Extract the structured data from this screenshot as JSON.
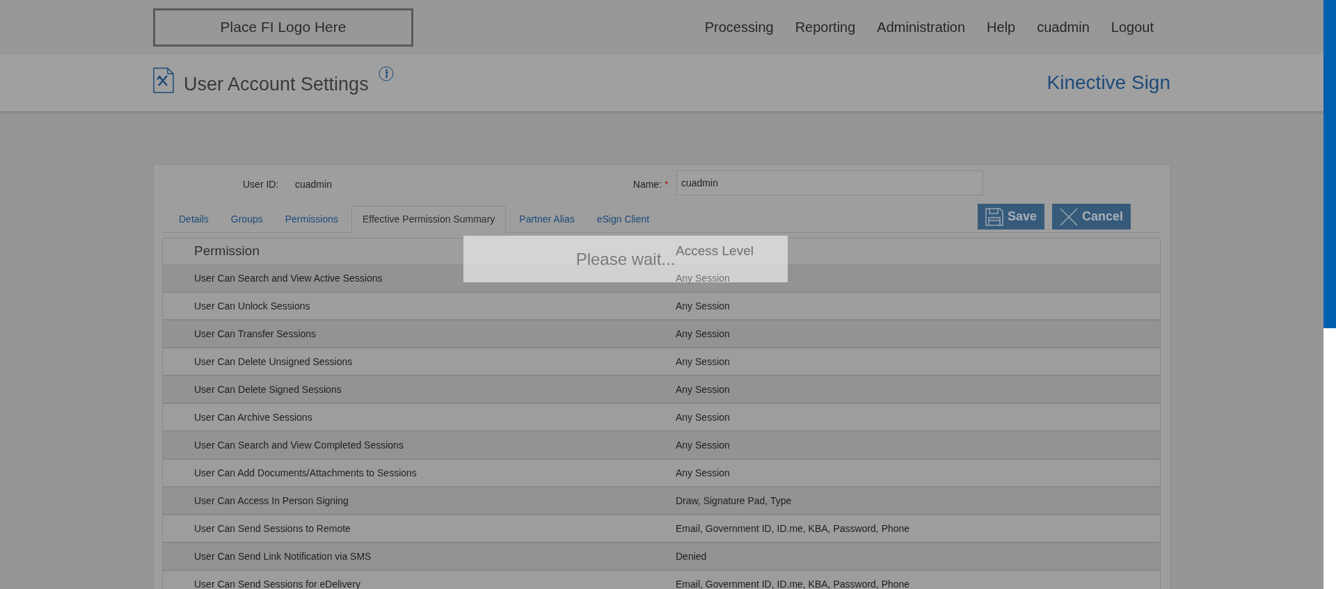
{
  "logo": {
    "text": "Place FI Logo Here"
  },
  "nav": [
    "Processing",
    "Reporting",
    "Administration",
    "Help",
    "cuadmin",
    "Logout"
  ],
  "page_title": "User Account Settings",
  "brand": "Kinective Sign",
  "user_id": {
    "label": "User ID:",
    "value": "cuadmin"
  },
  "name_field": {
    "label": "Name:",
    "required": true,
    "required_mark": "*",
    "value": "cuadmin"
  },
  "tabs": [
    {
      "label": "Details",
      "selected": false
    },
    {
      "label": "Groups",
      "selected": false
    },
    {
      "label": "Permissions",
      "selected": false
    },
    {
      "label": "Effective Permission Summary",
      "selected": true
    },
    {
      "label": "Partner Alias",
      "selected": false
    },
    {
      "label": "eSign Client",
      "selected": false
    }
  ],
  "buttons": [
    {
      "kind": "save",
      "label": "Save"
    },
    {
      "kind": "cancel",
      "label": "Cancel"
    }
  ],
  "table": {
    "columns": [
      "Permission",
      "Access Level"
    ],
    "rows": [
      [
        "User Can Search and View Active Sessions",
        "Any Session"
      ],
      [
        "User Can Unlock Sessions",
        "Any Session"
      ],
      [
        "User Can Transfer Sessions",
        "Any Session"
      ],
      [
        "User Can Delete Unsigned Sessions",
        "Any Session"
      ],
      [
        "User Can Delete Signed Sessions",
        "Any Session"
      ],
      [
        "User Can Archive Sessions",
        "Any Session"
      ],
      [
        "User Can Search and View Completed Sessions",
        "Any Session"
      ],
      [
        "User Can Add Documents/Attachments to Sessions",
        "Any Session"
      ],
      [
        "User Can Access In Person Signing",
        "Draw, Signature Pad, Type"
      ],
      [
        "User Can Send Sessions to Remote",
        "Email, Government ID, ID.me, KBA, Password, Phone"
      ],
      [
        "User Can Send Link Notification via SMS",
        "Denied"
      ],
      [
        "User Can Send Sessions for eDelivery",
        "Email, Government ID, ID.me, KBA, Password, Phone"
      ]
    ]
  },
  "loading": {
    "message": "Please wait..."
  }
}
